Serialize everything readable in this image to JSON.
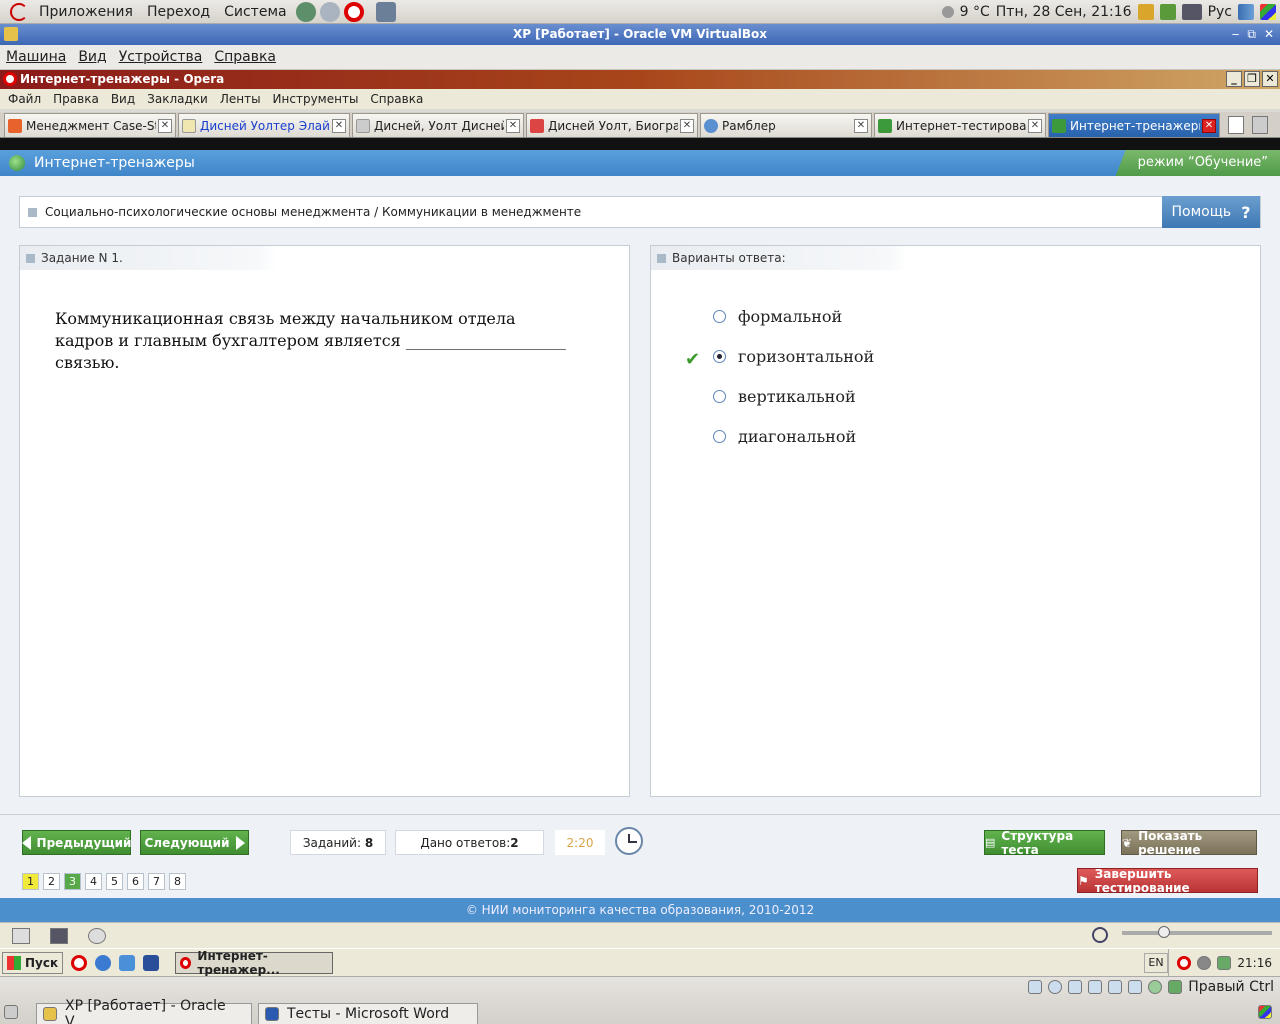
{
  "gnome_panel": {
    "menus": [
      "Приложения",
      "Переход",
      "Система"
    ],
    "weather": "9 °C",
    "datetime": "Птн, 28 Сен, 21:16",
    "keyboard_layout": "Рус"
  },
  "vbox": {
    "title": "XP [Работает] - Oracle VM VirtualBox",
    "menu": [
      "Машина",
      "Вид",
      "Устройства",
      "Справка"
    ]
  },
  "opera": {
    "title": "Интернет-тренажеры - Opera",
    "menu": [
      "Файл",
      "Правка",
      "Вид",
      "Закладки",
      "Ленты",
      "Инструменты",
      "Справка"
    ],
    "tabs": [
      {
        "label": "Менеджмент Case-Stud...",
        "icon_color": "#e8632b"
      },
      {
        "label": "Дисней Уолтер Элайас",
        "icon_color": "#f0e6b0"
      },
      {
        "label": "Дисней, Уолт Дисней",
        "icon_color": "#cccccc"
      },
      {
        "label": "Дисней Уолт, Биограф...",
        "icon_color": "#d44"
      },
      {
        "label": "Рамблер",
        "icon_color": "#5a8fd0"
      },
      {
        "label": "Интернет-тестирование",
        "icon_color": "#3c9a3c"
      },
      {
        "label": "Интернет-тренажеры",
        "icon_color": "#3c9a3c"
      }
    ]
  },
  "page": {
    "header_title": "Интернет-тренажеры",
    "mode": "режим “Обучение”",
    "breadcrumb": "Социально-психологические основы менеджмента / Коммуникации в менеджменте",
    "help_label": "Помощь",
    "help_symbol": "?",
    "task_heading": "Задание N 1.",
    "question": "Коммуникационная связь между начальником отдела кадров и главным бухгалтером является ____________________ связью.",
    "answers_heading": "Варианты ответа:",
    "options": [
      {
        "label": "формальной",
        "checked": false
      },
      {
        "label": "горизонтальной",
        "checked": true
      },
      {
        "label": "вертикальной",
        "checked": false
      },
      {
        "label": "диагональной",
        "checked": false
      }
    ],
    "prev_label": "Предыдущий",
    "next_label": "Следующий",
    "tasks_label": "Заданий:",
    "tasks_count": "8",
    "answered_label": "Дано ответов:",
    "answered_count": "2",
    "timer": "2:20",
    "structure_label": "Структура теста",
    "solution_label": "Показать решение",
    "finish_label": "Завершить тестирование",
    "pages": [
      "1",
      "2",
      "3",
      "4",
      "5",
      "6",
      "7",
      "8"
    ],
    "footer": "© НИИ мониторинга качества образования, 2010-2012"
  },
  "xp_taskbar": {
    "start_label": "Пуск",
    "task_label": "Интернет-тренажер...",
    "lang": "EN",
    "time": "21:16"
  },
  "host_bottom": {
    "tasks": [
      "XP [Работает] - Oracle V...",
      "Тесты - Microsoft Word"
    ],
    "host_key": "Правый Ctrl"
  }
}
